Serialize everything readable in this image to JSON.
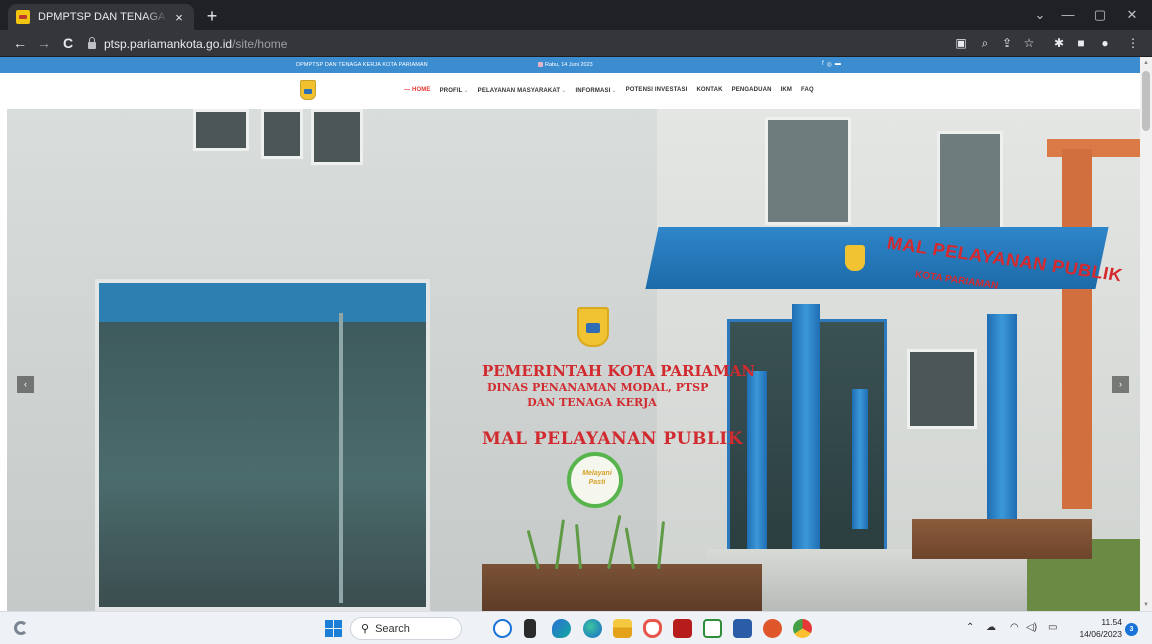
{
  "browser": {
    "tab_title": "DPMPTSP DAN TENAGA KERJA K",
    "tab_close": "×",
    "new_tab": "+",
    "url_domain": "ptsp.pariamankota.go.id",
    "url_path": "/site/home",
    "window_controls": {
      "minimize": "⌄",
      "restore": "—",
      "maximize": "▢",
      "close": "✕"
    },
    "nav": {
      "back": "←",
      "forward": "→",
      "reload": "C"
    }
  },
  "site": {
    "topbar": {
      "org_name": "DPMPTSP DAN TENAGA KERJA KOTA PARIAMAN",
      "date": "Rabu, 14 Juni 2023",
      "social": [
        "f",
        "◎",
        "▬"
      ]
    },
    "menu": [
      {
        "label": "HOME",
        "active": true,
        "dropdown": false
      },
      {
        "label": "PROFIL",
        "active": false,
        "dropdown": true
      },
      {
        "label": "PELAYANAN MASYARAKAT",
        "active": false,
        "dropdown": true
      },
      {
        "label": "INFORMASI",
        "active": false,
        "dropdown": true
      },
      {
        "label": "POTENSI INVESTASI",
        "active": false,
        "dropdown": false
      },
      {
        "label": "KONTAK",
        "active": false,
        "dropdown": false
      },
      {
        "label": "PENGADUAN",
        "active": false,
        "dropdown": false
      },
      {
        "label": "IKM",
        "active": false,
        "dropdown": false
      },
      {
        "label": "FAQ",
        "active": false,
        "dropdown": false
      }
    ],
    "hero": {
      "canopy_title": "MAL PELAYANAN PUBLIK",
      "canopy_subtitle": "KOTA PARIAMAN",
      "sign_line1": "PEMERINTAH KOTA PARIAMAN",
      "sign_line2": "DINAS PENANAMAN MODAL, PTSP",
      "sign_line3": "DAN TENAGA KERJA",
      "sign_line4": "MAL  PELAYANAN PUBLIK",
      "badge_text": "Melayani Pasti",
      "prev_arrow": "‹",
      "next_arrow": "›"
    }
  },
  "taskbar": {
    "search_label": "Search",
    "apps": [
      "bing-icon",
      "file-manager-icon",
      "copilot-icon",
      "edge-icon",
      "explorer-icon",
      "brave-icon",
      "app-red-icon",
      "xbox-icon",
      "word-icon",
      "office-icon",
      "chrome-icon"
    ],
    "time": "11.54",
    "date": "14/06/2023",
    "notifications": "3"
  },
  "colors": {
    "topbar_blue": "#3c8dd0",
    "active_menu": "#e53935",
    "chrome_dark": "#202124"
  }
}
